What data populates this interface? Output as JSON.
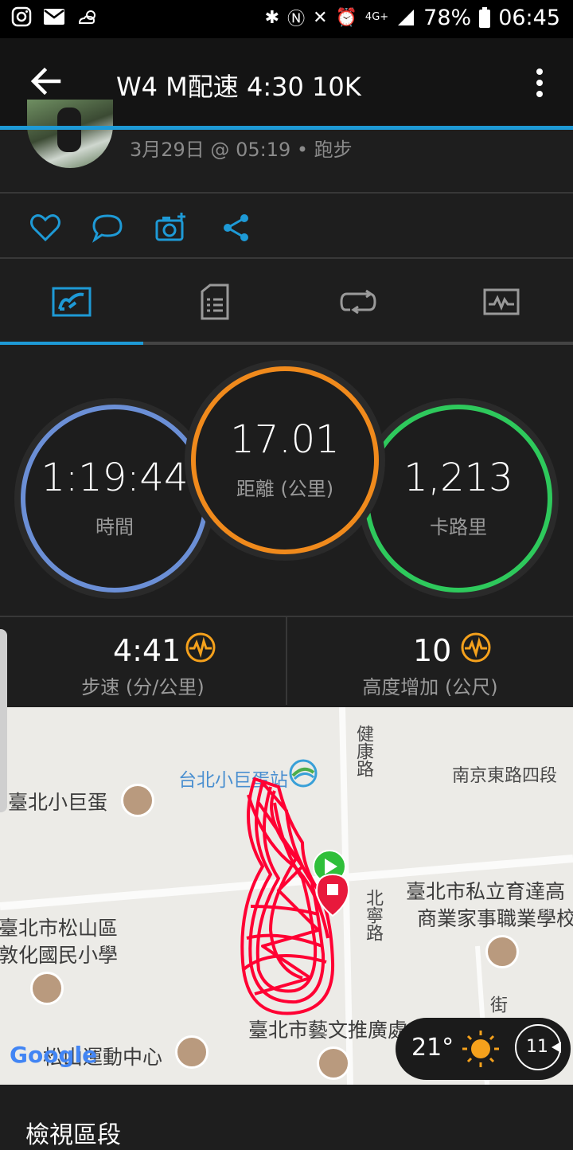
{
  "status_bar": {
    "battery": "78%",
    "time": "06:45",
    "network": "4G+"
  },
  "app_bar": {
    "title": "W4 M配速 4:30 10K"
  },
  "activity": {
    "meta": "3月29日 @ 05:19 • 跑步"
  },
  "tabs": [
    "summary-icon",
    "details-icon",
    "laps-icon",
    "chart-icon"
  ],
  "circles": {
    "time": {
      "value": "1:19:44",
      "label": "時間",
      "color": "#6b8fd6"
    },
    "distance": {
      "value": "17.01",
      "label": "距離 (公里)",
      "color": "#f08a1c"
    },
    "calories": {
      "value": "1,213",
      "label": "卡路里",
      "color": "#2ec95c"
    }
  },
  "stats": {
    "pace": {
      "value": "4:41",
      "label": "步速 (分/公里)"
    },
    "elevation": {
      "value": "10",
      "label": "高度增加 (公尺)"
    }
  },
  "map": {
    "labels": {
      "jiankang": "健康路",
      "station": "台北小巨蛋站",
      "nanjing": "南京東路四段",
      "arena": "臺北小巨蛋",
      "school1": "臺北市私立育達高",
      "school2": "商業家事職業學校",
      "songshan1": "臺北市松山區",
      "songshan2": "敦化國民小學",
      "beining": "北寧路",
      "arts": "臺北市藝文推廣處",
      "sports": "松山運動中心",
      "street": "街",
      "google": "Google"
    }
  },
  "weather": {
    "temp": "21°",
    "wind": "11"
  },
  "bottom": {
    "view_laps": "檢視區段"
  },
  "colors": {
    "accent": "#1e9ad6",
    "route": "#ff0033",
    "stat_icon": "#f5a11c"
  }
}
